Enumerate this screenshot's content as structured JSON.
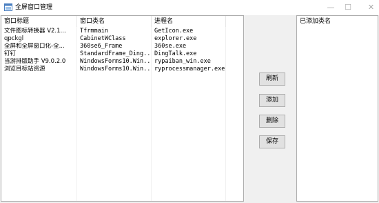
{
  "window": {
    "title": "全屏窗口管理",
    "minimize_glyph": "—",
    "maximize_glyph": "☐",
    "close_glyph": "✕",
    "icon": "app-window-icon"
  },
  "table": {
    "columns": [
      "窗口标题",
      "窗口类名",
      "进程名"
    ],
    "rows": [
      [
        "文件图标转换器 V2.1...",
        "Tfrmmain",
        "GetIcon.exe"
      ],
      [
        "qpckgl",
        "CabinetWClass",
        "explorer.exe"
      ],
      [
        "全屏和全屏窗口化-全...",
        "360se6_Frame",
        "360se.exe"
      ],
      [
        "钉钉",
        "StandardFrame_Ding...",
        "DingTalk.exe"
      ],
      [
        "当游排版助手 V9.0.2.0",
        "WindowsForms10.Win...",
        "rypaiban_win.exe"
      ],
      [
        "浏览目标站资源",
        "WindowsForms10.Win...",
        "ryprocessmanager.exe"
      ]
    ]
  },
  "buttons": {
    "refresh": "刷新",
    "add": "添加",
    "delete": "删除",
    "save": "保存"
  },
  "added_list": {
    "header": "已添加类名",
    "items": []
  }
}
